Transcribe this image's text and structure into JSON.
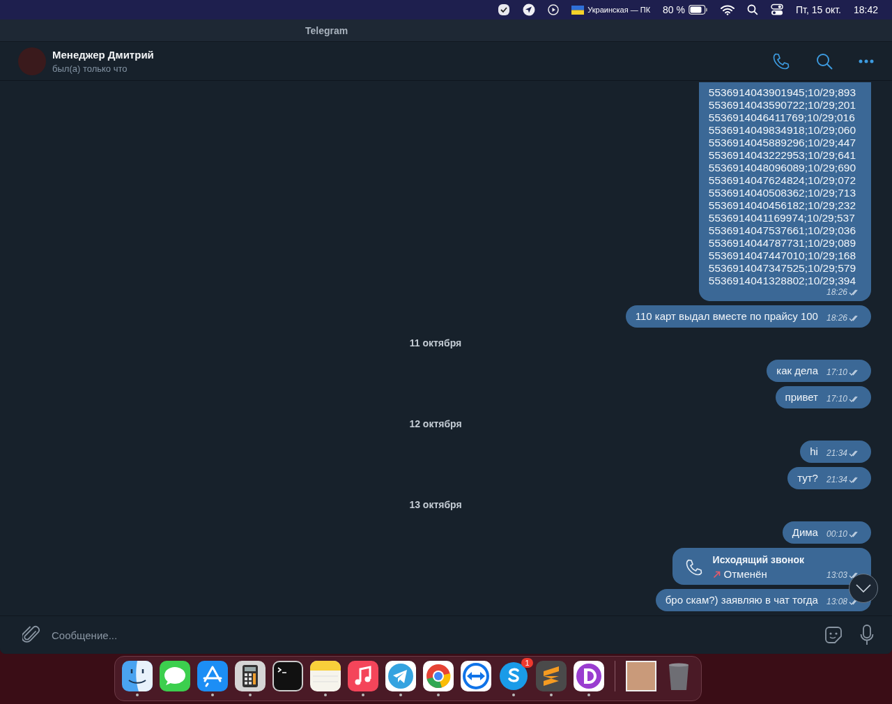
{
  "menu_bar": {
    "items": [
      {
        "kind": "check"
      },
      {
        "kind": "location"
      },
      {
        "kind": "play"
      },
      {
        "kind": "flag",
        "label": "Украинская — ПК"
      },
      {
        "kind": "battery",
        "label": "80 %"
      },
      {
        "kind": "wifi"
      },
      {
        "kind": "search"
      },
      {
        "kind": "control"
      },
      {
        "kind": "text",
        "label": "Пт, 15 окт."
      },
      {
        "kind": "text",
        "label": "18:42"
      }
    ]
  },
  "window": {
    "title": "Telegram"
  },
  "chat_header": {
    "name": "Менеджер Дмитрий",
    "status": "был(а) только что",
    "actions": [
      {
        "kind": "phone"
      },
      {
        "kind": "search"
      },
      {
        "kind": "more"
      }
    ]
  },
  "messages": [
    {
      "kind": "list",
      "time": "18:26",
      "read": true,
      "lines": [
        "5536914043901945;10/29;893",
        "5536914043590722;10/29;201",
        "5536914046411769;10/29;016",
        "5536914049834918;10/29;060",
        "5536914045889296;10/29;447",
        "5536914043222953;10/29;641",
        "5536914048096089;10/29;690",
        "5536914047624824;10/29;072",
        "5536914040508362;10/29;713",
        "5536914040456182;10/29;232",
        "5536914041169974;10/29;537",
        "5536914047537661;10/29;036",
        "5536914044787731;10/29;089",
        "5536914047447010;10/29;168",
        "5536914047347525;10/29;579",
        "5536914041328802;10/29;394"
      ]
    },
    {
      "kind": "text",
      "text": "110 карт выдал вместе по прайсу 100",
      "time": "18:26",
      "read": true
    },
    {
      "kind": "date",
      "text": "11 октября"
    },
    {
      "kind": "text",
      "text": "как дела",
      "time": "17:10",
      "read": true
    },
    {
      "kind": "text",
      "text": "привет",
      "time": "17:10",
      "read": true
    },
    {
      "kind": "date",
      "text": "12 октября"
    },
    {
      "kind": "text",
      "text": "hi",
      "time": "21:34",
      "read": true
    },
    {
      "kind": "text",
      "text": "тут?",
      "time": "21:34",
      "read": true
    },
    {
      "kind": "date",
      "text": "13 октября"
    },
    {
      "kind": "text",
      "text": "Дима",
      "time": "00:10",
      "read": true
    },
    {
      "kind": "call",
      "title": "Исходящий звонок",
      "status": "Отменён",
      "time": "13:03",
      "read": true
    },
    {
      "kind": "text",
      "text": "бро скам?) заявляю в чат тогда",
      "time": "13:08",
      "read": true
    }
  ],
  "composer": {
    "placeholder": "Сообщение..."
  },
  "dock": {
    "apps": [
      {
        "kind": "finder",
        "running": true
      },
      {
        "kind": "messages",
        "running": false
      },
      {
        "kind": "appstore",
        "running": true
      },
      {
        "kind": "calculator",
        "running": true
      },
      {
        "kind": "terminal",
        "running": false
      },
      {
        "kind": "notes",
        "running": true
      },
      {
        "kind": "music",
        "running": true
      },
      {
        "kind": "telegram",
        "running": true
      },
      {
        "kind": "chrome",
        "running": true
      },
      {
        "kind": "teamviewer",
        "running": false
      },
      {
        "kind": "skype",
        "running": true,
        "badge": "1"
      },
      {
        "kind": "sublime",
        "running": true
      },
      {
        "kind": "d",
        "running": true
      },
      {
        "kind": "separator"
      },
      {
        "kind": "photo",
        "running": false
      },
      {
        "kind": "trash",
        "running": false
      }
    ]
  }
}
